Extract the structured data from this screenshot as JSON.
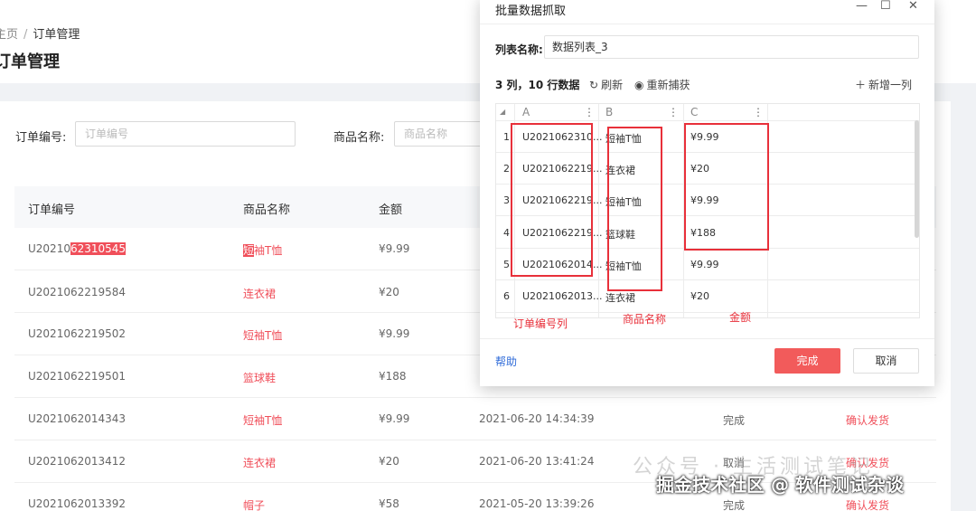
{
  "breadcrumb": {
    "home": "主页",
    "sep": "/",
    "current": "订单管理"
  },
  "page_title": "订单管理",
  "filters": [
    {
      "label": "订单编号:",
      "placeholder": "订单编号"
    },
    {
      "label": "商品名称:",
      "placeholder": "商品名称"
    }
  ],
  "table": {
    "headers": [
      "订单编号",
      "商品名称",
      "金额"
    ],
    "rows": [
      {
        "id_prefix": "U20210",
        "id_highlight": "62310545",
        "product_hl": "短",
        "product_rest": "袖T恤",
        "amount": "¥9.99",
        "time": "",
        "status": "",
        "action": ""
      },
      {
        "id": "U2021062219584",
        "product": "连衣裙",
        "amount": "¥20",
        "time": "",
        "status": "",
        "action": ""
      },
      {
        "id": "U2021062219502",
        "product": "短袖T恤",
        "amount": "¥9.99",
        "time": "",
        "status": "",
        "action": ""
      },
      {
        "id": "U2021062219501",
        "product": "篮球鞋",
        "amount": "¥188",
        "time": "",
        "status": "",
        "action": ""
      },
      {
        "id": "U2021062014343",
        "product": "短袖T恤",
        "amount": "¥9.99",
        "time": "2021-06-20 14:34:39",
        "status": "完成",
        "action": "确认发货"
      },
      {
        "id": "U2021062013412",
        "product": "连衣裙",
        "amount": "¥20",
        "time": "2021-06-20 13:41:24",
        "status": "取消",
        "action": "确认发货"
      },
      {
        "id": "U2021062013392",
        "product": "帽子",
        "amount": "¥58",
        "time": "2021-05-20 13:39:26",
        "status": "完成",
        "action": "确认发货"
      }
    ]
  },
  "dialog": {
    "title": "批量数据抓取",
    "controls": {
      "minimize": "—",
      "maximize": "☐",
      "close": "✕"
    },
    "list_name_label": "列表名称:",
    "list_name_value": "数据列表_3",
    "summary": "3 列，10 行数据",
    "refresh": "刷新",
    "recapture": "重新捕获",
    "add_column": "新增一列",
    "grid": {
      "corner": "◢",
      "columns": [
        "A",
        "B",
        "C"
      ],
      "rows": [
        [
          "1",
          "U2021062310...",
          "短袖T恤",
          "¥9.99"
        ],
        [
          "2",
          "U2021062219...",
          "连衣裙",
          "¥20"
        ],
        [
          "3",
          "U2021062219...",
          "短袖T恤",
          "¥9.99"
        ],
        [
          "4",
          "U2021062219...",
          "篮球鞋",
          "¥188"
        ],
        [
          "5",
          "U2021062014...",
          "短袖T恤",
          "¥9.99"
        ],
        [
          "6",
          "U2021062013...",
          "连衣裙",
          "¥20"
        ]
      ]
    },
    "annotations": [
      "订单编号列",
      "商品名称",
      "金额"
    ],
    "help": "帮助",
    "done": "完成",
    "cancel": "取消"
  },
  "watermark": {
    "line1": "公众号 · 生活测试笔记",
    "line2": "掘金技术社区 @ 软件测试杂谈"
  },
  "colors": {
    "accent": "#f04f5a",
    "annotation": "#e8303a",
    "link": "#2f6bd8"
  }
}
